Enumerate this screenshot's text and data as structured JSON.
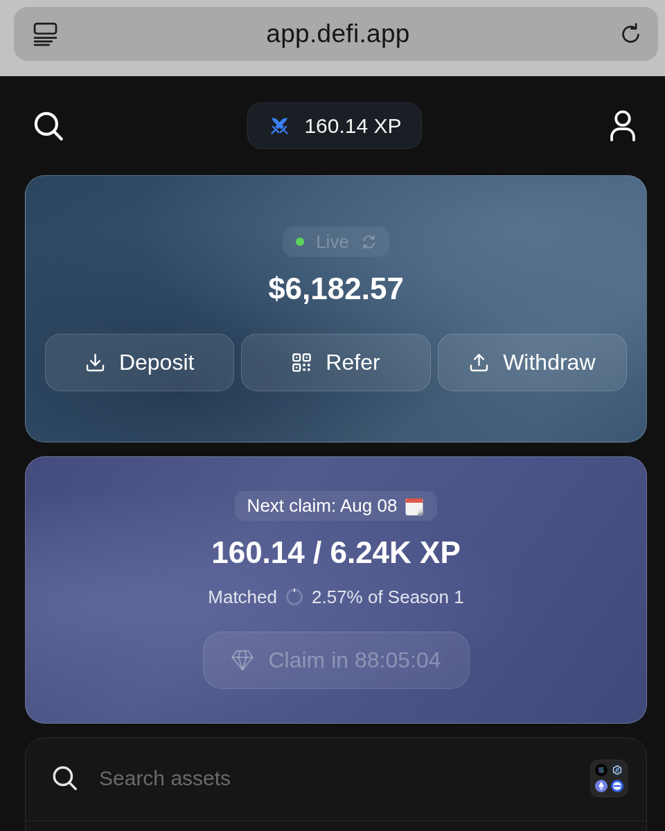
{
  "browser": {
    "url": "app.defi.app"
  },
  "header": {
    "xp_badge": "160.14 XP"
  },
  "balance_card": {
    "status": {
      "label": "Live",
      "live": true
    },
    "amount": "$6,182.57",
    "actions": [
      {
        "label": "Deposit",
        "kind": "download"
      },
      {
        "label": "Refer",
        "kind": "qr"
      },
      {
        "label": "Withdraw",
        "kind": "upload"
      }
    ]
  },
  "rewards_card": {
    "next_claim": "Next claim: Aug 08",
    "xp_progress": "160.14 / 6.24K XP",
    "matched": {
      "label": "Matched",
      "reading": "2.57% of Season 1"
    },
    "claim_button": {
      "label": "Claim in 88:05:04",
      "disabled": true
    }
  },
  "assets": {
    "search": {
      "placeholder": "Search assets"
    }
  }
}
